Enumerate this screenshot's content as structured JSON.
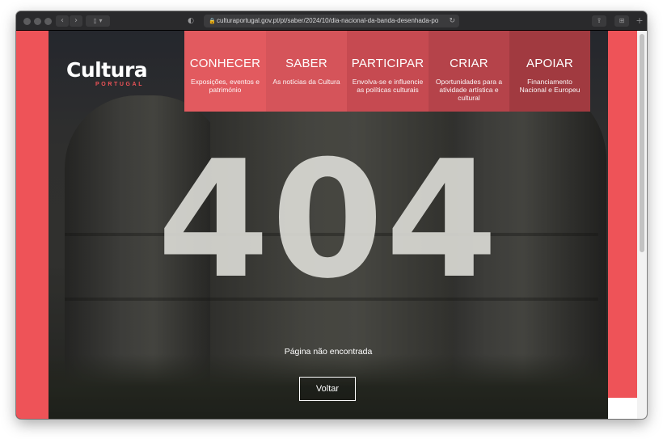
{
  "browser": {
    "url": "culturaportugal.gov.pt/pt/saber/2024/10/dia-nacional-da-banda-desenhada-po",
    "back_glyph": "‹",
    "forward_glyph": "›",
    "sidebar_glyph": "▯ ▾",
    "shield_glyph": "◐",
    "lock_glyph": "🔒",
    "reload_glyph": "↻",
    "share_glyph": "⇪",
    "tabs_glyph": "⊞",
    "newtab_glyph": "+"
  },
  "logo": {
    "name": "Cultura",
    "sub": "PORTUGAL"
  },
  "menu": [
    {
      "title": "CONHECER",
      "desc": "Exposições, eventos e património"
    },
    {
      "title": "SABER",
      "desc": "As notícias da Cultura"
    },
    {
      "title": "PARTICIPAR",
      "desc": "Envolva-se e influencie as políticas culturais"
    },
    {
      "title": "CRIAR",
      "desc": "Oportunidades para a atividade artística e cultural"
    },
    {
      "title": "APOIAR",
      "desc": "Financiamento Nacional e Europeu"
    }
  ],
  "error": {
    "code": "404",
    "message": "Página não encontrada",
    "back_label": "Voltar"
  },
  "colors": {
    "brand_red": "#ee5358"
  },
  "icons": [
    "lock-icon",
    "reload-icon",
    "shield-icon",
    "share-icon",
    "tabs-icon"
  ]
}
